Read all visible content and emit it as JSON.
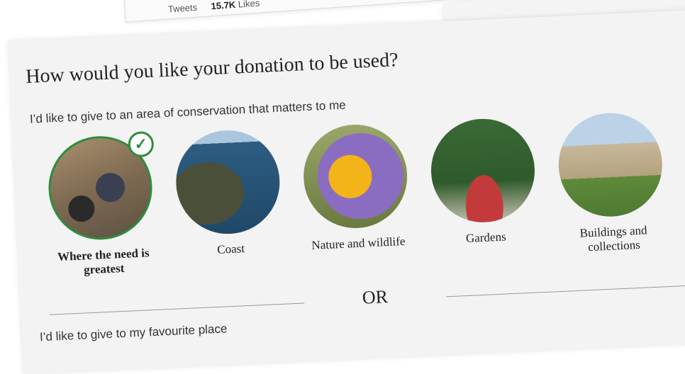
{
  "background_tweet": {
    "retweets_label": "Tweets",
    "likes_count": "15.7K",
    "likes_label": "Likes"
  },
  "donation": {
    "title": "How would you like your donation to be used?",
    "subtitle": "I’d like to give to an area of conservation that matters to me",
    "options": [
      {
        "label": "Where the need is greatest",
        "selected": true
      },
      {
        "label": "Coast",
        "selected": false
      },
      {
        "label": "Nature and wildlife",
        "selected": false
      },
      {
        "label": "Gardens",
        "selected": false
      },
      {
        "label": "Buildings and collections",
        "selected": false
      }
    ],
    "or_text": "OR",
    "favourite_place_text": "I’d like to give to my favourite place"
  },
  "colors": {
    "accent": "#2e8b3e",
    "card_bg": "#f3f3f3"
  },
  "icons": {
    "selected": "check-icon"
  }
}
